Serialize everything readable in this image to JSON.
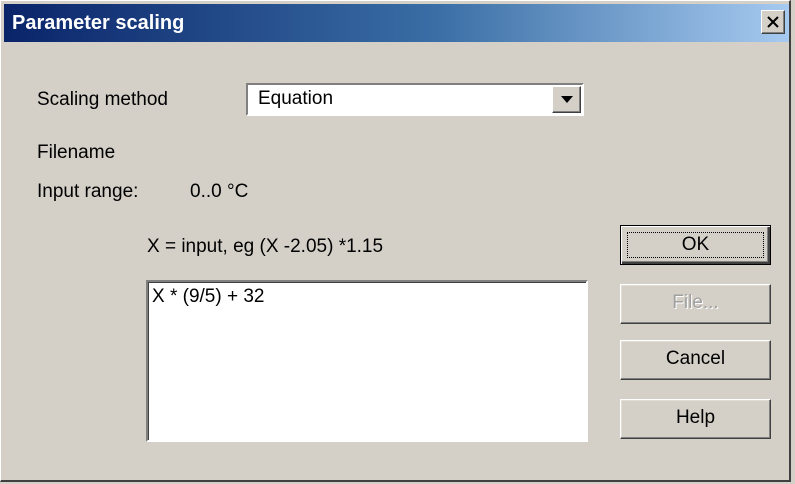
{
  "window": {
    "title": "Parameter scaling",
    "close_icon": "close-icon"
  },
  "form": {
    "scaling_method_label": "Scaling method",
    "scaling_method_value": "Equation",
    "filename_label": "Filename",
    "input_range_label": "Input range:",
    "input_range_value": "0..0 °C",
    "hint": "X = input, eg (X -2.05) *1.15",
    "equation": "X * (9/5) + 32"
  },
  "buttons": {
    "ok": "OK",
    "file": "File...",
    "file_disabled": true,
    "cancel": "Cancel",
    "help": "Help"
  },
  "colors": {
    "title_gradient_start": "#0a246a",
    "title_gradient_end": "#a6caf0",
    "dialog_bg": "#d4d0c8",
    "disabled_text": "#a0a0a0"
  }
}
